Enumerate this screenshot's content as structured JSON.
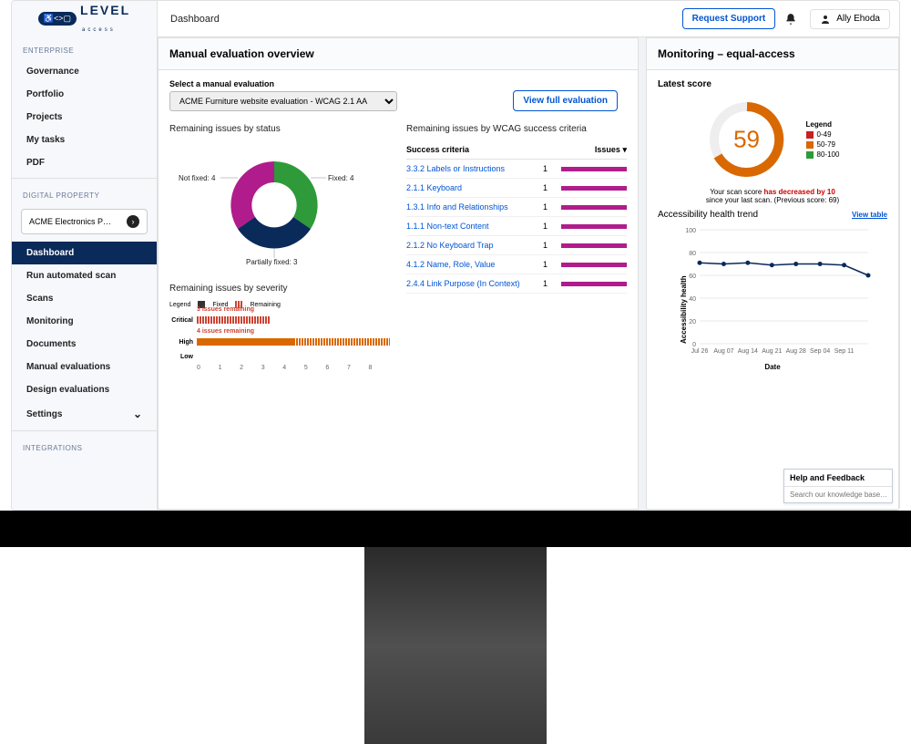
{
  "header": {
    "breadcrumb": "Dashboard",
    "request_support": "Request Support",
    "user_name": "Ally Ehoda"
  },
  "logo": {
    "brand": "LEVEL",
    "sub": "access"
  },
  "sidebar": {
    "section_enterprise": "ENTERPRISE",
    "enterprise_items": [
      "Governance",
      "Portfolio",
      "Projects",
      "My tasks",
      "PDF"
    ],
    "section_property": "DIGITAL PROPERTY",
    "property_selected": "ACME Electronics P…",
    "property_items": [
      "Dashboard",
      "Run automated scan",
      "Scans",
      "Monitoring",
      "Documents",
      "Manual evaluations",
      "Design evaluations",
      "Settings"
    ],
    "active_index": 0,
    "section_integrations": "INTEGRATIONS"
  },
  "manual_panel": {
    "title": "Manual evaluation overview",
    "select_label": "Select a manual evaluation",
    "select_value": "ACME Furniture website evaluation - WCAG 2.1 AA",
    "view_full": "View full evaluation",
    "status_title": "Remaining issues by status",
    "wcag_title": "Remaining issues by WCAG success criteria",
    "wcag_header_sc": "Success criteria",
    "wcag_header_issues": "Issues",
    "severity_title": "Remaining issues by severity",
    "severity_legend_label": "Legend",
    "severity_legend_fixed": "Fixed",
    "severity_legend_remaining": "Remaining"
  },
  "donut": {
    "segments": [
      {
        "label": "Fixed: 4",
        "value": 4,
        "color": "#2e9a3a"
      },
      {
        "label": "Not fixed: 4",
        "value": 4,
        "color": "#b01c8b"
      },
      {
        "label": "Partially fixed: 3",
        "value": 3,
        "color": "#0a2a5a"
      }
    ]
  },
  "wcag_rows": [
    {
      "code": "3.3.2",
      "name": "Labels or Instructions",
      "count": 1
    },
    {
      "code": "2.1.1",
      "name": "Keyboard",
      "count": 1
    },
    {
      "code": "1.3.1",
      "name": "Info and Relationships",
      "count": 1
    },
    {
      "code": "1.1.1",
      "name": "Non-text Content",
      "count": 1
    },
    {
      "code": "2.1.2",
      "name": "No Keyboard Trap",
      "count": 1
    },
    {
      "code": "4.1.2",
      "name": "Name, Role, Value",
      "count": 1
    },
    {
      "code": "2.4.4",
      "name": "Link Purpose (In Context)",
      "count": 1
    }
  ],
  "severity": {
    "critical_label": "Critical",
    "critical_remaining_text": "3 issues remaining",
    "critical_fixed": 0,
    "critical_remaining": 3,
    "high_label": "High",
    "high_remaining_text": "4 issues remaining",
    "high_fixed": 4,
    "high_remaining": 4,
    "low_label": "Low",
    "axis": [
      "0",
      "1",
      "2",
      "3",
      "4",
      "5",
      "6",
      "7",
      "8"
    ]
  },
  "monitoring_panel": {
    "title": "Monitoring – equal-access",
    "latest_score_label": "Latest score",
    "score": 59,
    "legend_label": "Legend",
    "legend": [
      {
        "range": "0-49",
        "color": "#c92020"
      },
      {
        "range": "50-79",
        "color": "#d96800"
      },
      {
        "range": "80-100",
        "color": "#2e9a3a"
      }
    ],
    "score_msg_prefix": "Your scan score ",
    "score_msg_delta": "has decreased by 10",
    "score_msg_suffix": "since your last scan. (Previous score: 69)",
    "trend_title": "Accessibility health trend",
    "view_table": "View table",
    "y_axis_label": "Accessibility health",
    "x_axis_label": "Date"
  },
  "chart_data": {
    "gauge": {
      "type": "pie",
      "value": 59,
      "max": 100,
      "ranges": [
        [
          0,
          49
        ],
        [
          50,
          79
        ],
        [
          80,
          100
        ]
      ]
    },
    "trend": {
      "type": "line",
      "x": [
        "Jul 26",
        "Aug 07",
        "Aug 14",
        "Aug 21",
        "Aug 28",
        "Sep 04",
        "Sep 11",
        ""
      ],
      "y": [
        71,
        70,
        71,
        69,
        70,
        70,
        69,
        60
      ],
      "ylim": [
        0,
        100
      ],
      "ylabel": "Accessibility health",
      "xlabel": "Date"
    },
    "donut": {
      "type": "pie",
      "series": [
        {
          "name": "Fixed",
          "value": 4
        },
        {
          "name": "Not fixed",
          "value": 4
        },
        {
          "name": "Partially fixed",
          "value": 3
        }
      ]
    },
    "severity_bars": {
      "type": "bar",
      "categories": [
        "Critical",
        "High",
        "Low"
      ],
      "series": [
        {
          "name": "Fixed",
          "values": [
            0,
            4,
            0
          ]
        },
        {
          "name": "Remaining",
          "values": [
            3,
            4,
            0
          ]
        }
      ],
      "xlim": [
        0,
        8
      ]
    }
  },
  "help": {
    "title": "Help and Feedback",
    "placeholder": "Search our knowledge base…"
  }
}
